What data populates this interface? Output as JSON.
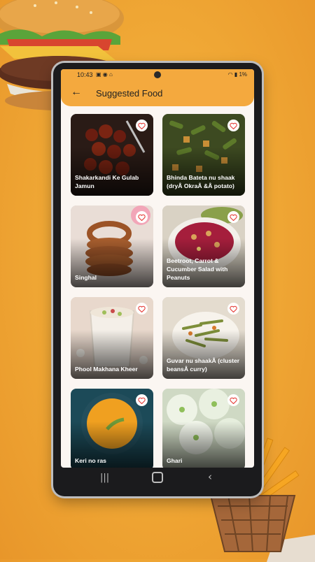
{
  "status": {
    "time": "10:43",
    "battery": "1%"
  },
  "appbar": {
    "title": "Suggested Food"
  },
  "items": [
    {
      "name": "Shakarkandi Ke Gulab Jamun"
    },
    {
      "name": "Bhinda Bateta nu shaak (dryÂ OkraÂ &Â potato)"
    },
    {
      "name": "Singhal"
    },
    {
      "name": "Beetroot, Carrot & Cucumber Salad with Peanuts"
    },
    {
      "name": "Phool Makhana Kheer"
    },
    {
      "name": "Guvar nu shaakÂ (cluster beansÂ curry)"
    },
    {
      "name": "Keri no ras"
    },
    {
      "name": "Ghari"
    }
  ],
  "colors": {
    "accent": "#f4a93e",
    "heart": "#e53935"
  }
}
